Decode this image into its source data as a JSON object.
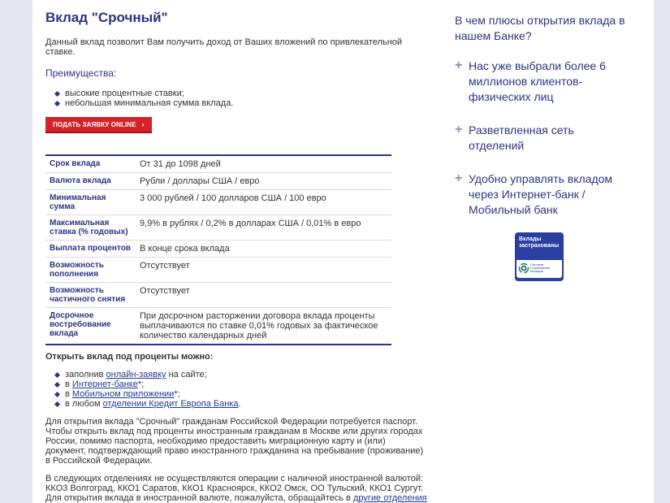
{
  "main": {
    "title": "Вклад \"Срочный\"",
    "intro": "Данный вклад позволит Вам получить доход от Ваших вложений по привлекательной ставке.",
    "advantages_heading": "Преимущества:",
    "advantages": [
      "высокие процентные ставки;",
      "небольшая минимальная сумма вклада."
    ],
    "apply_button": "ПОДАТЬ ЗАЯВКУ ONLINE",
    "apply_arrow": "›",
    "terms": [
      {
        "k": "Срок вклада",
        "v": "От 31 до 1098 дней"
      },
      {
        "k": "Валюта вклада",
        "v": "Рубли / доллары США / евро"
      },
      {
        "k": "Минимальная сумма",
        "v": "3 000 рублей / 100 долларов США / 100 евро"
      },
      {
        "k": "Максимальная ставка (% годовых)",
        "v": "9,9% в рублях / 0,2% в долларах США / 0,01% в евро"
      },
      {
        "k": "Выплата процентов",
        "v": "В конце срока вклада"
      },
      {
        "k": "Возможность пополнения",
        "v": "Отсутствует"
      },
      {
        "k": "Возможность частичного снятия",
        "v": "Отсутствует"
      },
      {
        "k": "Досрочное востребование вклада",
        "v": "При досрочном расторжении договора вклада проценты выплачиваются по ставке 0,01% годовых за фактическое количество календарных дней"
      }
    ],
    "open_heading": "Открыть вклад под проценты можно:",
    "open_items": [
      {
        "pre": "заполнив ",
        "link": "онлайн-заявку",
        "post": " на сайте;"
      },
      {
        "pre": "в ",
        "link": "Интернет-банке",
        "post": "*;"
      },
      {
        "pre": "в ",
        "link": "Мобильном приложении",
        "post": "*;"
      },
      {
        "pre": "в любом ",
        "link": "отделении Кредит Европа Банка",
        "post": "."
      }
    ],
    "passport_text": "Для открытия вклада \"Срочный\" гражданам Российской Федерации потребуется паспорт. Чтобы открыть вклад под проценты иностранным гражданам в Москве или других городах России, помимо паспорта, необходимо предоставить миграционную карту и (или) документ, подтверждающий право иностранного гражданина на пребывание (проживание) в Российской Федерации.",
    "branches_text_pre": "В следующих отделениях не осуществляются операции с наличной иностранной валютой: ККО3 Волгоград, ККО1 Саратов, ККО1 Красноярск, ККО2 Омск, ОО Тульский, ККО1 Сургут. Для открытия вклада в иностранной валюте, пожалуйста, обращайтесь в ",
    "branches_link": "другие отделения Банка",
    "branches_text_post": "."
  },
  "side": {
    "heading": "В чем плюсы открытия вклада в нашем Банке?",
    "plus_glyph": "+",
    "items": [
      "Нас уже выбрали более 6 миллионов клиентов-физических лиц",
      "Разветвленная сеть отделений",
      "Удобно управлять вкладом через Интернет-банк / Мобильный банк"
    ],
    "badge_title": "Вклады застрахованы",
    "badge_sub": "Система Страхования Вкладов"
  },
  "colors": {
    "brand": "#2b3580",
    "button": "#d3222a",
    "background": "#e4e7f2"
  }
}
